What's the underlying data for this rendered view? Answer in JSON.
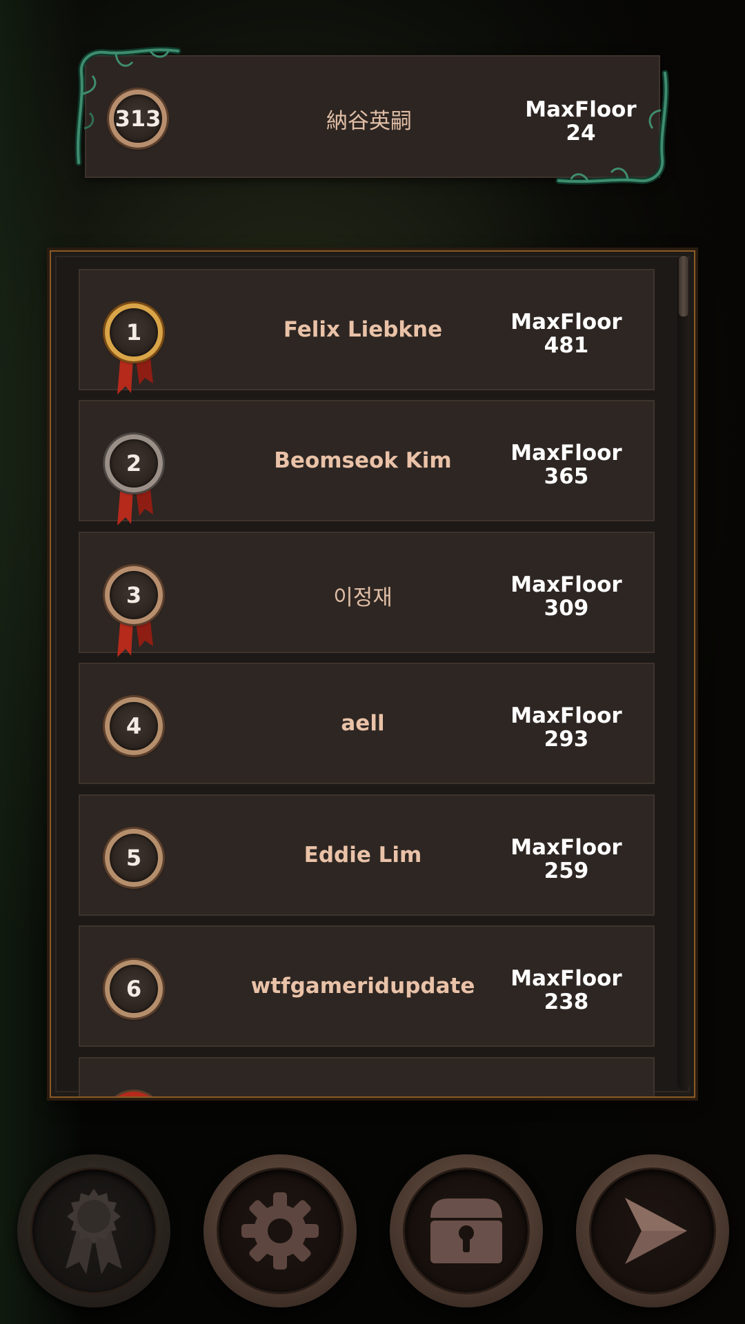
{
  "my_rank": {
    "rank": "313",
    "name": "納谷英嗣",
    "score_label": "MaxFloor",
    "score_value": "24"
  },
  "leaderboard": [
    {
      "rank": "1",
      "name": "Felix Liebkne",
      "score_label": "MaxFloor",
      "score_value": "481",
      "medal": "gold"
    },
    {
      "rank": "2",
      "name": "Beomseok Kim",
      "score_label": "MaxFloor",
      "score_value": "365",
      "medal": "silver"
    },
    {
      "rank": "3",
      "name": "이정재",
      "score_label": "MaxFloor",
      "score_value": "309",
      "medal": "bronze"
    },
    {
      "rank": "4",
      "name": "aell",
      "score_label": "MaxFloor",
      "score_value": "293",
      "medal": "plain"
    },
    {
      "rank": "5",
      "name": "Eddie Lim",
      "score_label": "MaxFloor",
      "score_value": "259",
      "medal": "plain"
    },
    {
      "rank": "6",
      "name": "wtfgameridupdate",
      "score_label": "MaxFloor",
      "score_value": "238",
      "medal": "plain"
    }
  ],
  "nav": {
    "items": [
      {
        "icon": "ranking-ribbon-icon"
      },
      {
        "icon": "gear-icon"
      },
      {
        "icon": "locked-chest-icon"
      },
      {
        "icon": "play-arrow-icon"
      }
    ]
  },
  "colors": {
    "card_bg": "#2e2622",
    "name_text": "#e9c2a8",
    "panel_border": "#8a5a26",
    "gold_medal": "#d9a548",
    "silver_medal": "#9a9088",
    "ribbon_red": "#b62a1c"
  }
}
